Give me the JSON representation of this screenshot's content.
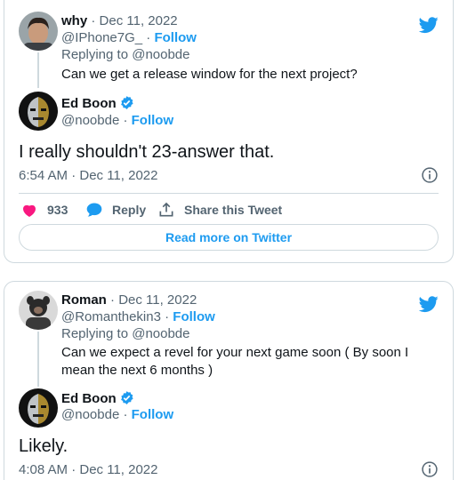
{
  "tweets": [
    {
      "parent": {
        "name": "why",
        "date": "Dec 11, 2022",
        "handle": "@IPhone7G_",
        "follow": "Follow",
        "replying_to": "Replying to @noobde",
        "text": "Can we get a release window for the next project?"
      },
      "main": {
        "name": "Ed Boon",
        "handle": "@noobde",
        "follow": "Follow",
        "text": "I really shouldn't 23-answer that.",
        "timestamp": "6:54 AM · Dec 11, 2022"
      },
      "actions": {
        "likes": "933",
        "reply": "Reply",
        "share": "Share this Tweet"
      },
      "read_more": "Read more on Twitter"
    },
    {
      "parent": {
        "name": "Roman",
        "date": "Dec 11, 2022",
        "handle": "@Romanthekin3",
        "follow": "Follow",
        "replying_to": "Replying to @noobde",
        "text": "Can we expect a revel for your next game soon ( By soon I mean the next 6 months )"
      },
      "main": {
        "name": "Ed Boon",
        "handle": "@noobde",
        "follow": "Follow",
        "text": "Likely.",
        "timestamp": "4:08 AM · Dec 11, 2022"
      }
    }
  ],
  "separator": "·",
  "colors": {
    "twitter_blue": "#1d9bf0",
    "like_red": "#f91880",
    "muted": "#536471",
    "border": "#cfd9de"
  },
  "icons": [
    "twitter-bird-icon",
    "verified-badge-icon",
    "info-icon",
    "heart-icon",
    "reply-bubble-icon",
    "share-icon"
  ]
}
